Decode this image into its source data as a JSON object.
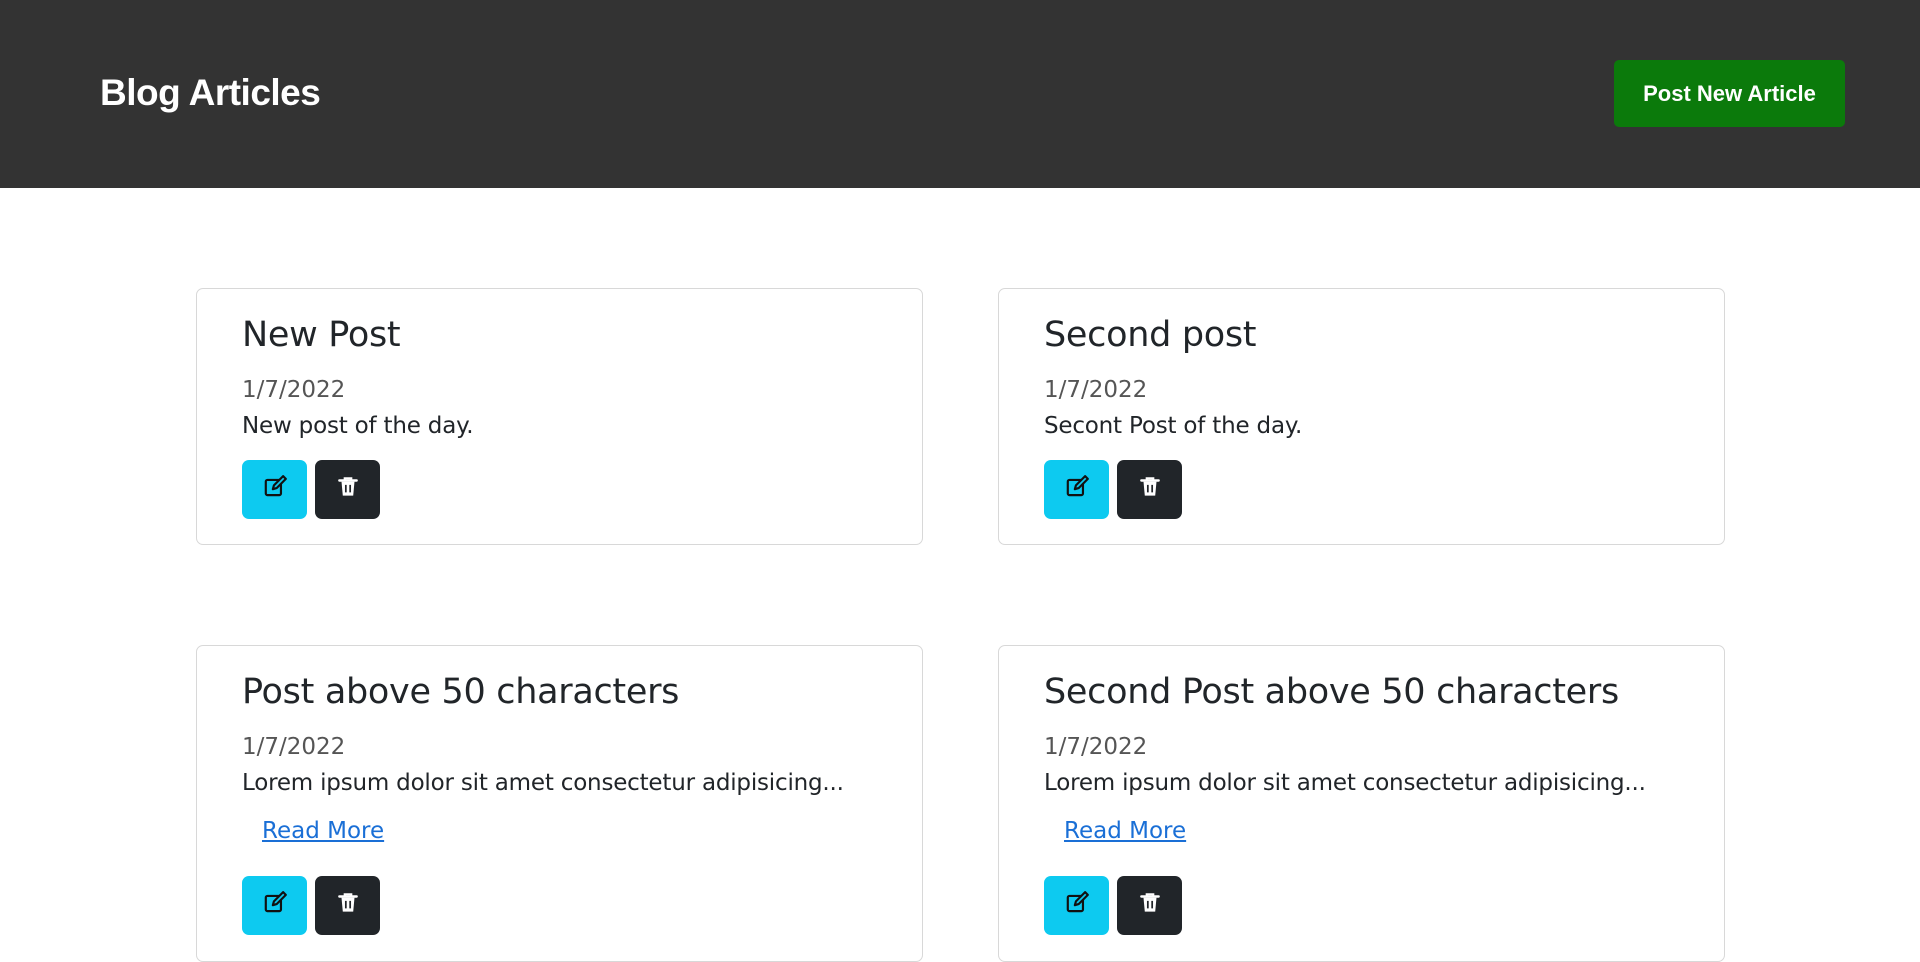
{
  "header": {
    "title": "Blog Articles",
    "post_new_label": "Post New Article",
    "background_color": "#333333",
    "button_color": "#0b7a0b"
  },
  "icons": {
    "edit": "edit-icon",
    "delete": "trash-icon"
  },
  "posts": [
    {
      "title": "New Post",
      "date": "1/7/2022",
      "body": "New post of the day.",
      "read_more": ""
    },
    {
      "title": "Second post",
      "date": "1/7/2022",
      "body": "Secont Post of the day.",
      "read_more": ""
    },
    {
      "title": "Post above 50 characters",
      "date": "1/7/2022",
      "body": "Lorem ipsum dolor sit amet consectetur adipisicing...",
      "read_more": "Read More"
    },
    {
      "title": "Second Post above 50 characters",
      "date": "1/7/2022",
      "body": "Lorem ipsum dolor sit amet consectetur adipisicing...",
      "read_more": "Read More"
    }
  ]
}
